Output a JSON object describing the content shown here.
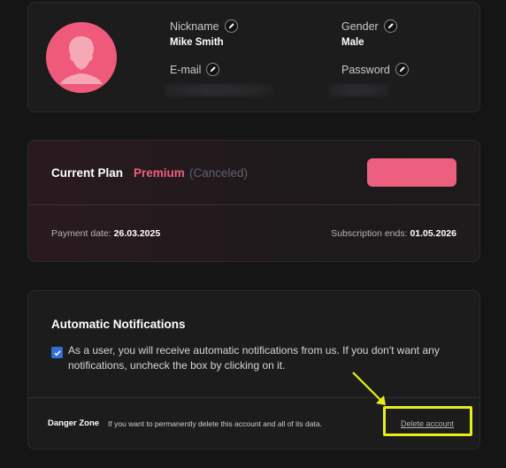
{
  "profile": {
    "nickname_label": "Nickname",
    "nickname_value": "Mike Smith",
    "gender_label": "Gender",
    "gender_value": "Male",
    "email_label": "E-mail",
    "password_label": "Password"
  },
  "plan": {
    "title": "Current Plan",
    "name": "Premium",
    "status": "(Canceled)",
    "button_label": "",
    "payment_label": "Payment date:",
    "payment_value": "26.03.2025",
    "subscription_label": "Subscription ends:",
    "subscription_value": "01.05.2026"
  },
  "notifications": {
    "title": "Automatic Notifications",
    "checked": true,
    "text": "As a user, you will receive automatic notifications from us. If you don't want any notifications, uncheck the box by clicking on it."
  },
  "danger": {
    "label": "Danger Zone",
    "text": "If you want to permanently delete this account and all of its data.",
    "delete_label": "Delete account"
  },
  "colors": {
    "accent_pink": "#ec5f7e",
    "highlight_yellow": "#e6ef1a",
    "checkbox_blue": "#2f6fd8"
  },
  "icons": {
    "edit": "pencil-icon",
    "avatar": "user-silhouette",
    "checkbox": "checkmark-icon",
    "annotation": "arrow-annotation"
  }
}
